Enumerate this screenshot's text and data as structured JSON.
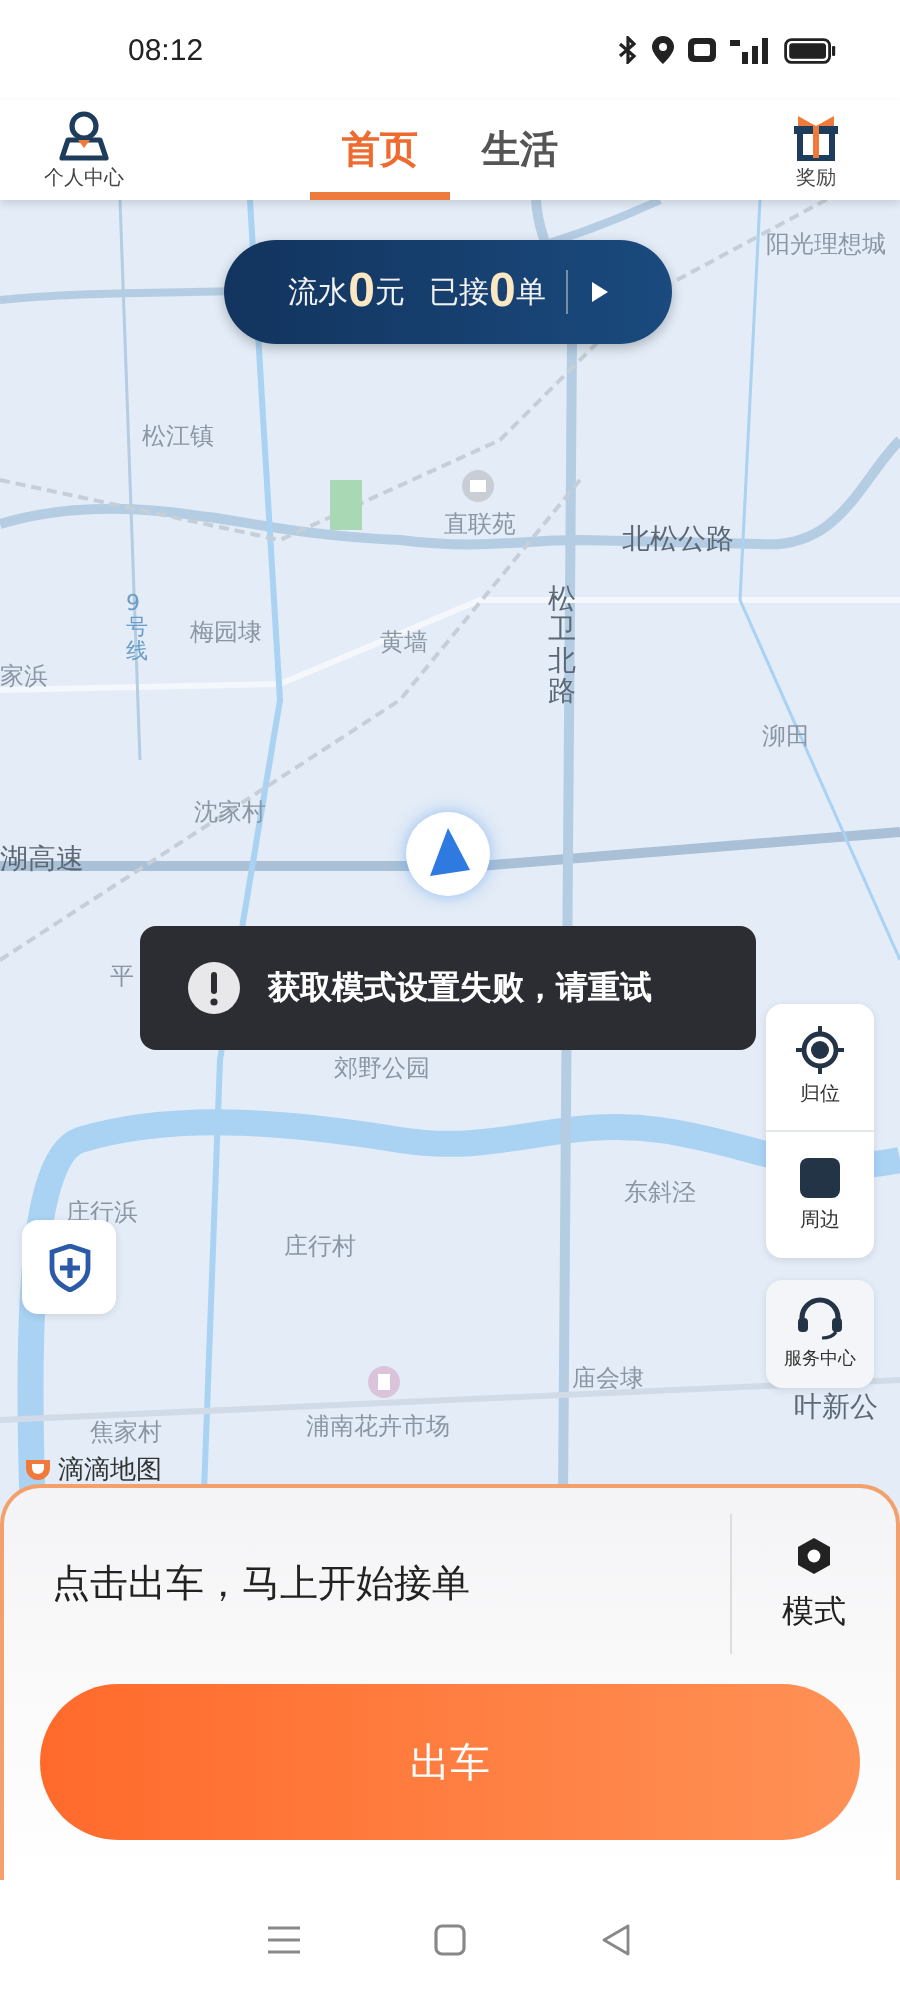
{
  "status_bar": {
    "time": "08:12"
  },
  "header": {
    "profile_label": "个人中心",
    "tabs": [
      {
        "label": "首页",
        "selected": true
      },
      {
        "label": "生活",
        "selected": false
      }
    ],
    "rewards_label": "奖励"
  },
  "earnings_bar": {
    "income_label": "流水",
    "income_value": "0",
    "income_unit": "元",
    "orders_label": "已接",
    "orders_value": "0",
    "orders_unit": "单"
  },
  "map": {
    "labels": [
      {
        "text": "阳光理想城",
        "kind": "place"
      },
      {
        "text": "松江镇",
        "kind": "place"
      },
      {
        "text": "直联苑",
        "kind": "place"
      },
      {
        "text": "北松公路",
        "kind": "road"
      },
      {
        "text": "9号线",
        "kind": "line"
      },
      {
        "text": "梅园埭",
        "kind": "place"
      },
      {
        "text": "黄墙",
        "kind": "place"
      },
      {
        "text": "松卫北路",
        "kind": "vroad"
      },
      {
        "text": "家浜",
        "kind": "place"
      },
      {
        "text": "泖田",
        "kind": "place"
      },
      {
        "text": "沈家村",
        "kind": "place"
      },
      {
        "text": "湖高速",
        "kind": "road"
      },
      {
        "text": "平",
        "kind": "place"
      },
      {
        "text": "郊野公园",
        "kind": "place"
      },
      {
        "text": "庄行浜",
        "kind": "place"
      },
      {
        "text": "庄行村",
        "kind": "place"
      },
      {
        "text": "东斜泾",
        "kind": "place"
      },
      {
        "text": "庙会埭",
        "kind": "place"
      },
      {
        "text": "浦南花卉市场",
        "kind": "place"
      },
      {
        "text": "焦家村",
        "kind": "place"
      },
      {
        "text": "叶新公",
        "kind": "road"
      }
    ],
    "attribution": "滴滴地图"
  },
  "toast": {
    "message": "获取模式设置失败，请重试"
  },
  "map_controls": [
    {
      "label": "归位",
      "kind": "locate"
    },
    {
      "label": "周边",
      "kind": "nearby"
    }
  ],
  "service_center": {
    "label": "服务中心"
  },
  "bottom_sheet": {
    "prompt": "点击出车，马上开始接单",
    "mode_label": "模式",
    "go_button": "出车"
  }
}
